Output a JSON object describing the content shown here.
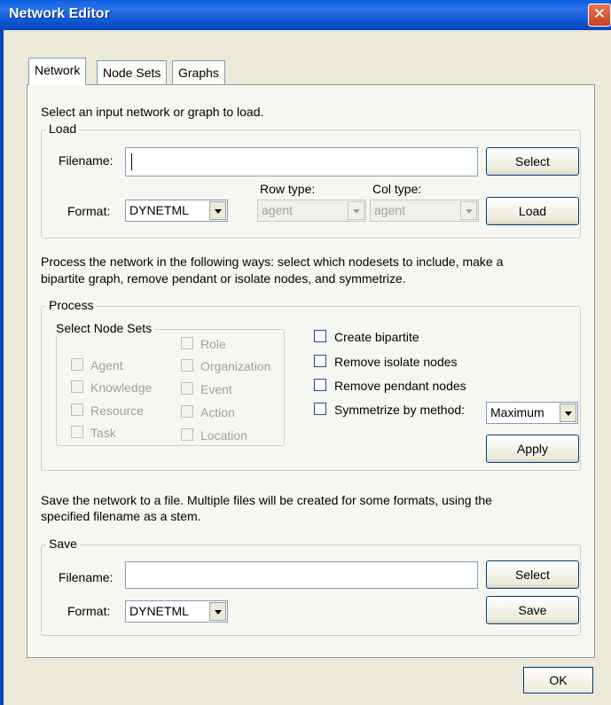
{
  "window": {
    "title": "Network Editor",
    "close_symbol": "✕"
  },
  "tabs": [
    {
      "label": "Network",
      "active": true
    },
    {
      "label": "Node Sets",
      "active": false
    },
    {
      "label": "Graphs",
      "active": false
    }
  ],
  "intro_text": "Select an input network or graph to load.",
  "load": {
    "legend": "Load",
    "filename_label": "Filename:",
    "filename_value": "",
    "select_button": "Select",
    "format_label": "Format:",
    "format_value": "DYNETML",
    "row_type_label": "Row type:",
    "row_type_value": "agent",
    "col_type_label": "Col type:",
    "col_type_value": "agent",
    "load_button": "Load"
  },
  "process_text_line1": "Process the network in the following ways: select which nodesets to include, make a",
  "process_text_line2": "bipartite graph, remove pendant or isolate nodes, and symmetrize.",
  "process": {
    "legend": "Process",
    "node_sets_legend": "Select Node Sets",
    "node_sets": {
      "agent": "Agent",
      "knowledge": "Knowledge",
      "resource": "Resource",
      "task": "Task",
      "role": "Role",
      "organization": "Organization",
      "event": "Event",
      "action": "Action",
      "location": "Location"
    },
    "create_bipartite": "Create bipartite",
    "remove_isolate": "Remove isolate nodes",
    "remove_pendant": "Remove pendant nodes",
    "symmetrize": "Symmetrize by method:",
    "symmetrize_method": "Maximum",
    "apply_button": "Apply"
  },
  "save_text_line1": "Save the network to a file.  Multiple files will be created for some formats, using the",
  "save_text_line2": "specified filename as a stem.",
  "save": {
    "legend": "Save",
    "filename_label": "Filename:",
    "filename_value": "",
    "select_button": "Select",
    "format_label": "Format:",
    "format_value": "DYNETML",
    "save_button": "Save"
  },
  "ok_button": "OK"
}
